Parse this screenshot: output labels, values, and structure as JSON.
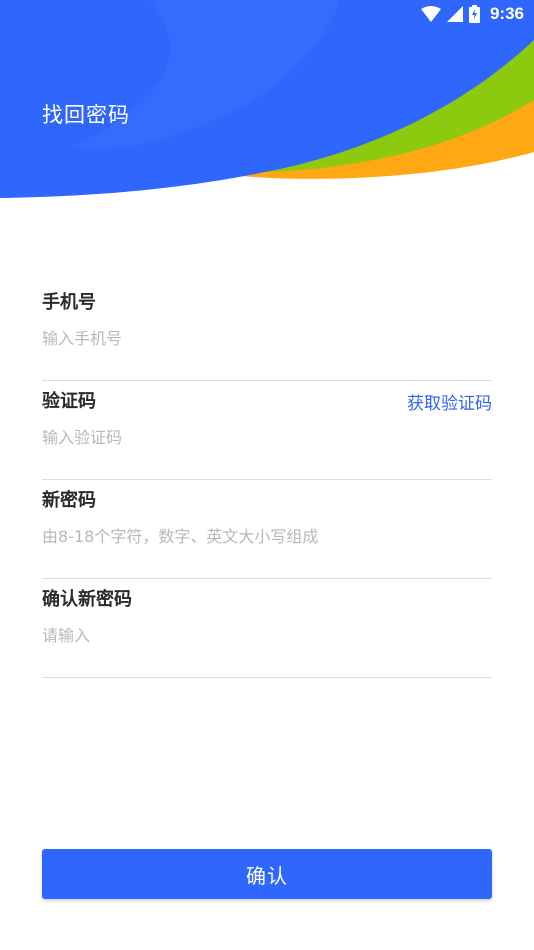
{
  "status_bar": {
    "time": "9:36",
    "icons": [
      "wifi-icon",
      "cell-signal-icon",
      "battery-charging-icon"
    ]
  },
  "header": {
    "title": "找回密码"
  },
  "form": {
    "phone": {
      "label": "手机号",
      "placeholder": "输入手机号",
      "value": ""
    },
    "code": {
      "label": "验证码",
      "placeholder": "输入验证码",
      "value": "",
      "get_code_label": "获取验证码"
    },
    "new_password": {
      "label": "新密码",
      "placeholder": "由8-18个字符，数字、英文大小写组成",
      "value": ""
    },
    "confirm_password": {
      "label": "确认新密码",
      "placeholder": "请输入",
      "value": ""
    }
  },
  "actions": {
    "confirm_label": "确认"
  },
  "colors": {
    "primary_blue": "#2f66fb",
    "accent_green": "#8cc90f",
    "accent_orange": "#ffa813",
    "link_blue": "#2f62f2"
  }
}
